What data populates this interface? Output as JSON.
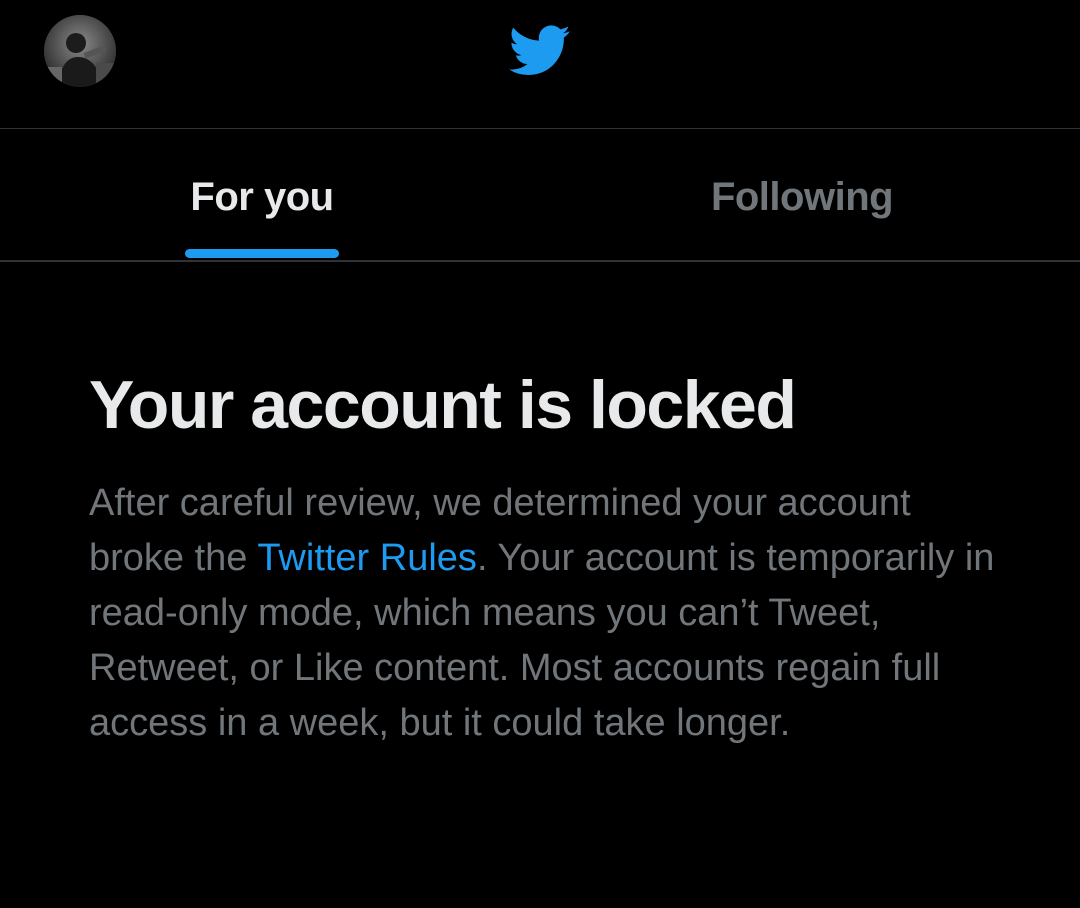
{
  "header": {
    "avatar_icon": "user-avatar",
    "logo_icon": "twitter-bird-icon",
    "brand_color": "#1d9bf0"
  },
  "tabs": [
    {
      "label": "For you",
      "active": true
    },
    {
      "label": "Following",
      "active": false
    }
  ],
  "notice": {
    "title": "Your account is locked",
    "body_before_link": "After careful review, we determined your account broke the ",
    "link_text": "Twitter Rules",
    "body_after_link": ". Your account is temporarily in read-only mode, which means you can’t Tweet, Retweet, or Like content. Most accounts regain full access in a week, but it could take longer."
  },
  "colors": {
    "background": "#000000",
    "primary_text": "#e7e9ea",
    "secondary_text": "#71767b",
    "accent": "#1d9bf0",
    "divider": "#2f3336"
  }
}
